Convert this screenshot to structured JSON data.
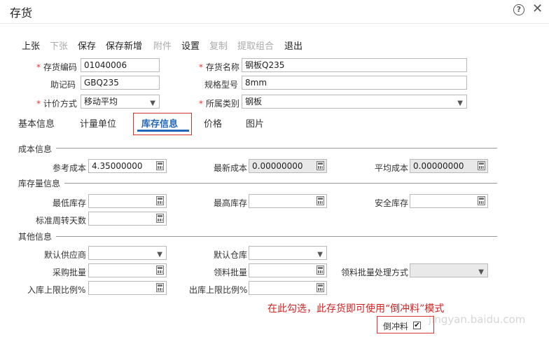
{
  "window": {
    "title": "存货",
    "help_glyph": "?",
    "close_glyph": "✕"
  },
  "toolbar": [
    {
      "label": "上张",
      "enabled": true
    },
    {
      "label": "下张",
      "enabled": false
    },
    {
      "label": "保存",
      "enabled": true
    },
    {
      "label": "保存新增",
      "enabled": true
    },
    {
      "label": "附件",
      "enabled": false
    },
    {
      "label": "设置",
      "enabled": true
    },
    {
      "label": "复制",
      "enabled": false
    },
    {
      "label": "提取组合",
      "enabled": false
    },
    {
      "label": "退出",
      "enabled": true
    }
  ],
  "header_fields": {
    "code": {
      "label": "存货编码",
      "required_mark": "*",
      "value": "01040006"
    },
    "name": {
      "label": "存货名称",
      "required_mark": "*",
      "value": "钢板Q235"
    },
    "mnemonic": {
      "label": "助记码",
      "value": "GBQ235"
    },
    "spec": {
      "label": "规格型号",
      "value": "8mm"
    },
    "pricing": {
      "label": "计价方式",
      "required_mark": "*",
      "value": "移动平均"
    },
    "category": {
      "label": "所属类别",
      "required_mark": "*",
      "value": "钢板"
    }
  },
  "tabs": [
    "基本信息",
    "计量单位",
    "库存信息",
    "价格",
    "图片"
  ],
  "active_tab": "库存信息",
  "sections": {
    "cost": "成本信息",
    "stock": "库存量信息",
    "other": "其他信息"
  },
  "cost": {
    "ref_cost": {
      "label": "参考成本",
      "value": "4.35000000"
    },
    "latest_cost": {
      "label": "最新成本",
      "value": "0.00000000"
    },
    "avg_cost": {
      "label": "平均成本",
      "value": "0.00000000"
    }
  },
  "stock": {
    "min": {
      "label": "最低库存",
      "value": ""
    },
    "max": {
      "label": "最高库存",
      "value": ""
    },
    "safety": {
      "label": "安全库存",
      "value": ""
    },
    "turnover_days": {
      "label": "标准周转天数",
      "value": ""
    }
  },
  "other": {
    "supplier": {
      "label": "默认供应商",
      "value": ""
    },
    "warehouse": {
      "label": "默认仓库",
      "value": ""
    },
    "purchase_qty": {
      "label": "采购批量",
      "value": ""
    },
    "issue_qty": {
      "label": "领料批量",
      "value": ""
    },
    "issue_mode": {
      "label": "领料批量处理方式",
      "value": ""
    },
    "in_limit": {
      "label": "入库上限比例%",
      "value": ""
    },
    "out_limit": {
      "label": "出库上限比例%",
      "value": ""
    }
  },
  "backflush": {
    "label": "倒冲料",
    "checked": true,
    "check_glyph": "✔"
  },
  "annotation": "在此勾选，此存货即可使用“倒冲料”模式",
  "watermark": "jingyan.baidu.com",
  "colors": {
    "accent": "#2266bb",
    "annotation_red": "#d42020",
    "required_red": "#ee3333"
  }
}
